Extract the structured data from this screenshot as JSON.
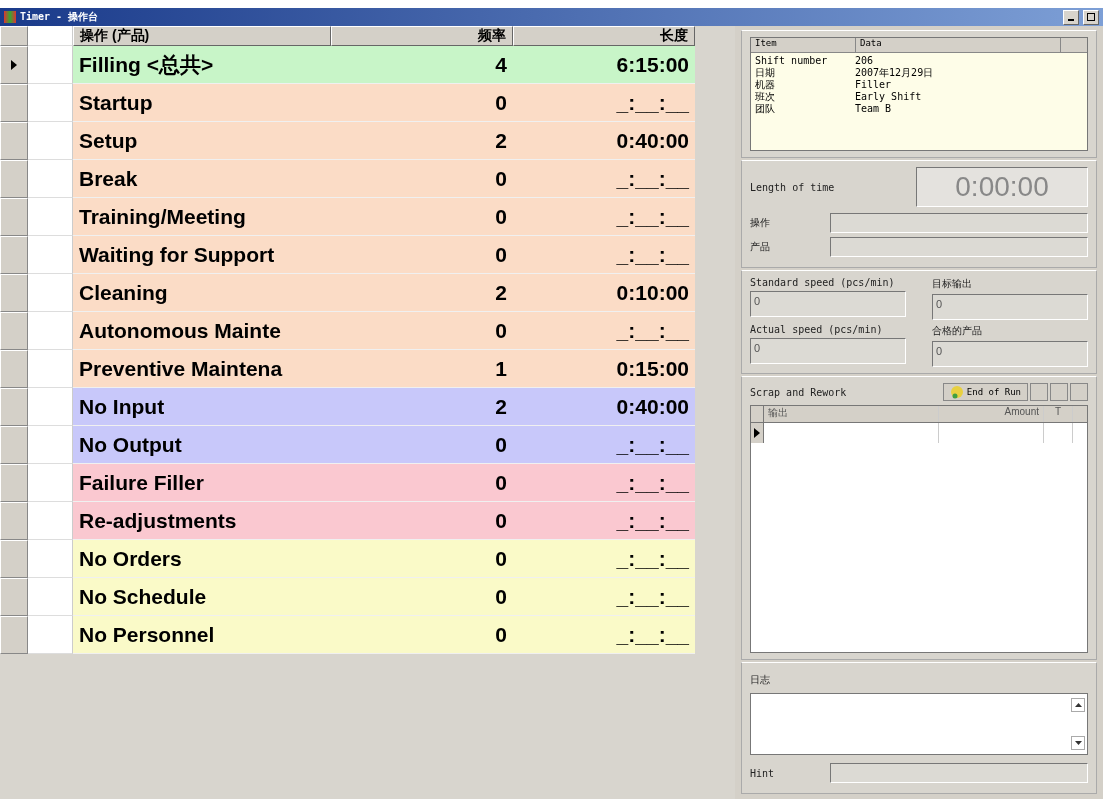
{
  "window": {
    "title": "Timer - 操作台"
  },
  "grid": {
    "columns": [
      "操作 (产品)",
      "频率",
      "长度"
    ],
    "rows": [
      {
        "name": "Filling <总共>",
        "count": "4",
        "length": "6:15:00",
        "color": "#c8f5c8",
        "selected": true
      },
      {
        "name": "Startup",
        "count": "0",
        "length": "_:__:__",
        "color": "#fbdcc6",
        "selected": false
      },
      {
        "name": "Setup",
        "count": "2",
        "length": "0:40:00",
        "color": "#fbdcc6",
        "selected": false
      },
      {
        "name": "Break",
        "count": "0",
        "length": "_:__:__",
        "color": "#fbdcc6",
        "selected": false
      },
      {
        "name": "Training/Meeting",
        "count": "0",
        "length": "_:__:__",
        "color": "#fbdcc6",
        "selected": false
      },
      {
        "name": "Waiting for Support",
        "count": "0",
        "length": "_:__:__",
        "color": "#fbdcc6",
        "selected": false
      },
      {
        "name": "Cleaning",
        "count": "2",
        "length": "0:10:00",
        "color": "#fbdcc6",
        "selected": false
      },
      {
        "name": "Autonomous Mainte",
        "count": "0",
        "length": "_:__:__",
        "color": "#fbdcc6",
        "selected": false
      },
      {
        "name": "Preventive Maintena",
        "count": "1",
        "length": "0:15:00",
        "color": "#fbdcc6",
        "selected": false
      },
      {
        "name": "No Input",
        "count": "2",
        "length": "0:40:00",
        "color": "#c8c8fa",
        "selected": false
      },
      {
        "name": "No Output",
        "count": "0",
        "length": "_:__:__",
        "color": "#c8c8fa",
        "selected": false
      },
      {
        "name": "Failure Filler",
        "count": "0",
        "length": "_:__:__",
        "color": "#fac8d0",
        "selected": false
      },
      {
        "name": "Re-adjustments",
        "count": "0",
        "length": "_:__:__",
        "color": "#fac8d0",
        "selected": false
      },
      {
        "name": "No Orders",
        "count": "0",
        "length": "_:__:__",
        "color": "#fafac8",
        "selected": false
      },
      {
        "name": "No Schedule",
        "count": "0",
        "length": "_:__:__",
        "color": "#fafac8",
        "selected": false
      },
      {
        "name": "No Personnel",
        "count": "0",
        "length": "_:__:__",
        "color": "#fafac8",
        "selected": false
      }
    ]
  },
  "info": {
    "columns": [
      "Item",
      "Data"
    ],
    "rows": [
      {
        "item": "Shift number",
        "data": "206"
      },
      {
        "item": "日期",
        "data": "2007年12月29日"
      },
      {
        "item": "机器",
        "data": "Filler"
      },
      {
        "item": "班次",
        "data": "Early Shift"
      },
      {
        "item": "团队",
        "data": "Team B"
      }
    ]
  },
  "timer": {
    "label": "Length of time",
    "value": "0:00:00"
  },
  "fields": [
    {
      "label": "操作"
    },
    {
      "label": "产品"
    }
  ],
  "speeds": [
    {
      "label": "Standard speed (pcs/min)",
      "value": "0"
    },
    {
      "label": "目标输出",
      "value": "0"
    },
    {
      "label": "Actual speed (pcs/min)",
      "value": "0"
    },
    {
      "label": "合格的产品",
      "value": "0"
    }
  ],
  "scrap": {
    "label": "Scrap and Rework",
    "button": "End of Run",
    "columns": [
      "输出",
      "Amount",
      "T"
    ],
    "rows": [
      {
        "selected": true
      }
    ]
  },
  "log": {
    "label": "日志"
  },
  "hint": {
    "label": "Hint"
  }
}
